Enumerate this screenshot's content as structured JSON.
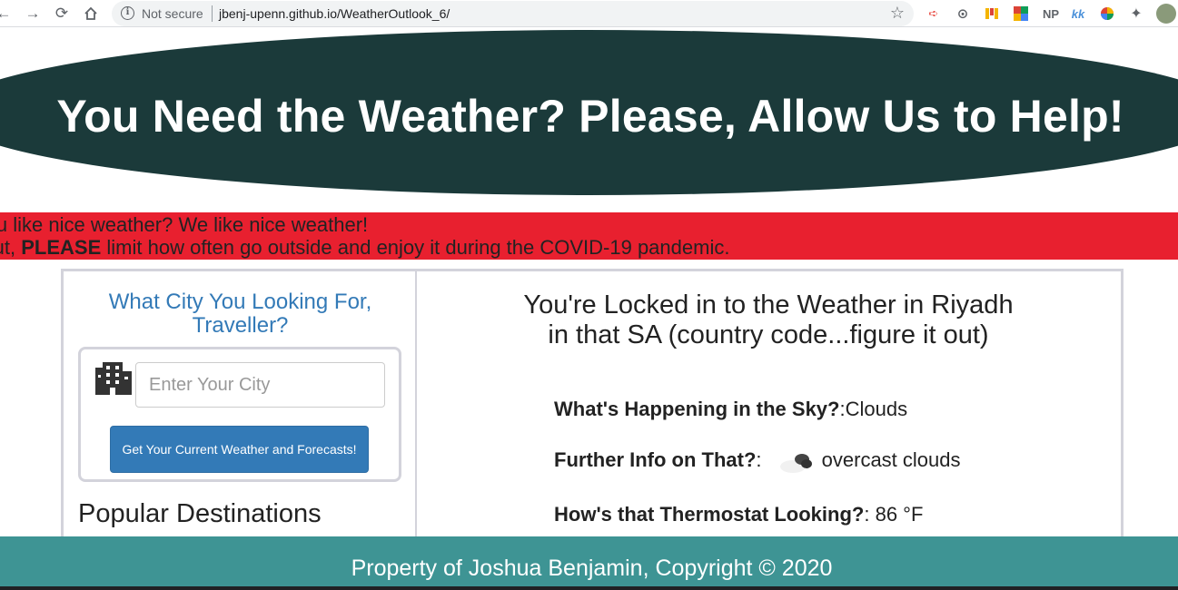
{
  "browser": {
    "security_label": "Not secure",
    "url": "jbenj-upenn.github.io/WeatherOutlook_6/",
    "extensions": [
      "NP",
      "kk"
    ]
  },
  "header": {
    "title": "You Need the Weather? Please, Allow Us to Help!"
  },
  "banner": {
    "line1": "You like nice weather? We like nice weather!",
    "line2_prefix": "But, ",
    "line2_bold": "PLEASE",
    "line2_suffix": " limit how often go outside and enjoy it during the COVID-19 pandemic."
  },
  "sidebar": {
    "heading": "What City You Looking For, Traveller?",
    "search": {
      "placeholder": "Enter Your City",
      "button_label": "Get Your Current Weather and Forecasts!"
    },
    "popular_heading": "Popular Destinations"
  },
  "weather": {
    "title": "You're Locked in to the Weather in Riyadh in that SA (country code...figure it out)",
    "sky_label": "What's Happening in the Sky?",
    "sky_value": "Clouds",
    "info_label": "Further Info on That?",
    "info_value": "overcast clouds",
    "temp_label": "How's that Thermostat Looking?",
    "temp_value": "86 °F"
  },
  "footer": {
    "text": "Property of Joshua Benjamin, Copyright © 2020"
  },
  "colors": {
    "header_bg": "#1b3a3a",
    "banner_bg": "#e8202f",
    "footer_bg": "#3e9494",
    "accent_blue": "#337ab7"
  }
}
